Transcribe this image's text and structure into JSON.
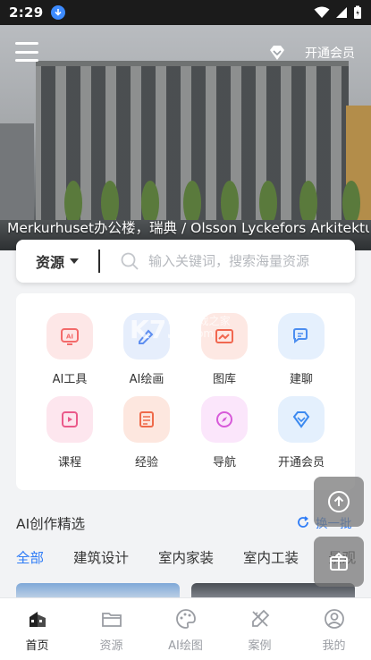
{
  "status_bar": {
    "time": "2:29"
  },
  "header": {
    "vip_label": "开通会员",
    "caption": "Merkurhuset办公楼，瑞典 / Olsson Lyckefors Arkitektur"
  },
  "search": {
    "type_label": "资源",
    "placeholder": "输入关键词，搜索海量资源"
  },
  "grid": {
    "items": [
      {
        "label": "AI工具",
        "icon": "ai-tool-icon",
        "color": "#f36a6a",
        "bg": "#fde7e7"
      },
      {
        "label": "AI绘画",
        "icon": "ai-paint-icon",
        "color": "#5e8ef0",
        "bg": "#e6eefc"
      },
      {
        "label": "图库",
        "icon": "gallery-icon",
        "color": "#f1674f",
        "bg": "#fde8e3"
      },
      {
        "label": "建聊",
        "icon": "chat-icon",
        "color": "#4c8ef0",
        "bg": "#e5f0fd"
      },
      {
        "label": "课程",
        "icon": "course-icon",
        "color": "#ea5a8a",
        "bg": "#fde6ee"
      },
      {
        "label": "经验",
        "icon": "experience-icon",
        "color": "#ef6a4a",
        "bg": "#fde7df"
      },
      {
        "label": "导航",
        "icon": "compass-icon",
        "color": "#d75ad9",
        "bg": "#fbe6fb"
      },
      {
        "label": "开通会员",
        "icon": "vip-diamond-icon",
        "color": "#3c8af0",
        "bg": "#e4f0fd"
      }
    ]
  },
  "watermark": {
    "main": "K73",
    "sub": "游戏之家",
    "sub2": ".com"
  },
  "section": {
    "title": "AI创作精选",
    "refresh_label": "换一批",
    "tabs": [
      "全部",
      "建筑设计",
      "室内家装",
      "室内工装",
      "景观"
    ]
  },
  "bottom_nav": [
    {
      "label": "首页",
      "icon": "home-icon",
      "active": true
    },
    {
      "label": "资源",
      "icon": "folder-icon",
      "active": false
    },
    {
      "label": "AI绘图",
      "icon": "palette-icon",
      "active": false
    },
    {
      "label": "案例",
      "icon": "design-tools-icon",
      "active": false
    },
    {
      "label": "我的",
      "icon": "user-icon",
      "active": false
    }
  ],
  "colors": {
    "accent": "#2f7cf6",
    "status_bar": "#1b1b1b"
  }
}
